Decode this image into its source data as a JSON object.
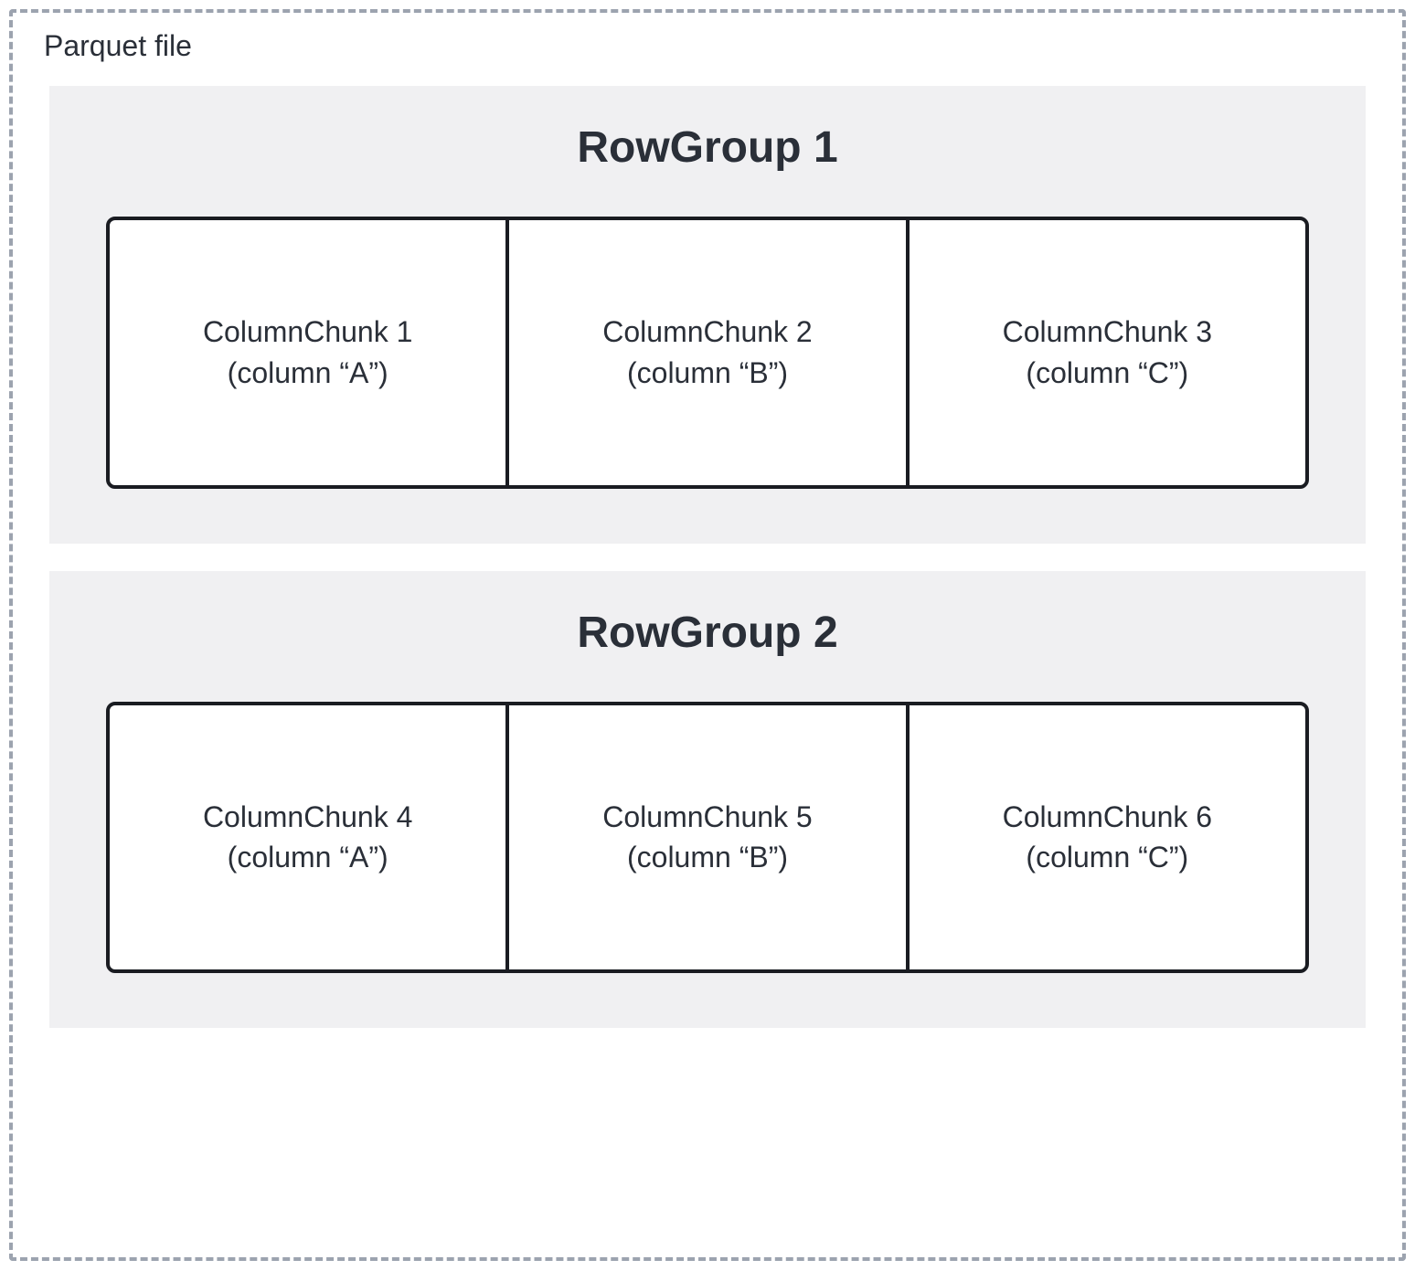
{
  "diagram": {
    "file_label": "Parquet file",
    "row_groups": [
      {
        "title": "RowGroup 1",
        "chunks": [
          {
            "name": "ColumnChunk 1",
            "column": "(column “A”)"
          },
          {
            "name": "ColumnChunk 2",
            "column": "(column “B”)"
          },
          {
            "name": "ColumnChunk 3",
            "column": "(column “C”)"
          }
        ]
      },
      {
        "title": "RowGroup 2",
        "chunks": [
          {
            "name": "ColumnChunk 4",
            "column": "(column “A”)"
          },
          {
            "name": "ColumnChunk 5",
            "column": "(column “B”)"
          },
          {
            "name": "ColumnChunk 6",
            "column": "(column “C”)"
          }
        ]
      }
    ]
  }
}
